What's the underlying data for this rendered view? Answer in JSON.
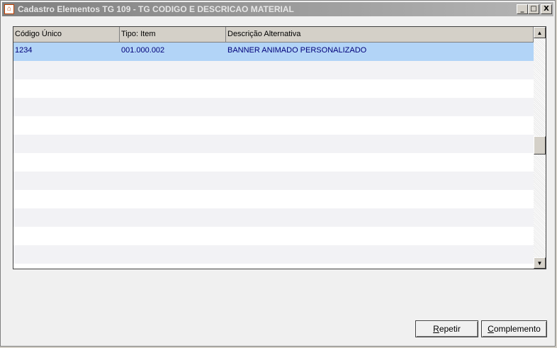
{
  "window": {
    "title": "Cadastro Elementos TG 109 - TG CODIGO E DESCRICAO MATERIAL",
    "icon": "app-house-icon",
    "controls": {
      "minimize": "_",
      "maximize": "□",
      "close": "X"
    }
  },
  "grid": {
    "columns": [
      "Código Único",
      "Tipo: Item",
      "Descrição Alternativa"
    ],
    "rows": [
      {
        "codigo": "1234",
        "tipo": "001.000.002",
        "descricao": "BANNER ANIMADO PERSONALIZADO",
        "selected": true
      }
    ],
    "empty_rows": 11
  },
  "buttons": {
    "repetir": "Repetir",
    "complemento": "Complemento"
  },
  "colors": {
    "selection": "#b2d4f7",
    "selection_text": "#00007a",
    "alt_row": "#f2f2f5"
  }
}
